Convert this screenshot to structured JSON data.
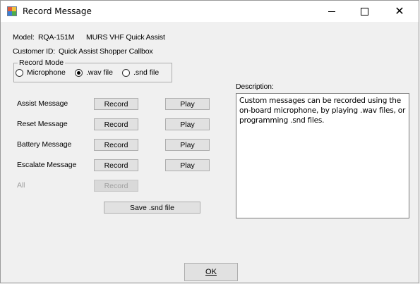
{
  "window": {
    "title": "Record Message",
    "icon": "app-window-icon",
    "controls": {
      "minimize": "minimize-icon",
      "maximize": "maximize-icon",
      "close": "close-icon"
    }
  },
  "info": {
    "model_label": "Model:",
    "model_value": "RQA-151M",
    "model_desc": "MURS VHF Quick Assist",
    "customer_label": "Customer ID:",
    "customer_value": "Quick Assist Shopper Callbox"
  },
  "record_mode": {
    "title": "Record Mode",
    "options": [
      {
        "label": "Microphone",
        "checked": false
      },
      {
        "label": ".wav file",
        "checked": true
      },
      {
        "label": ".snd file",
        "checked": false
      }
    ]
  },
  "messages": [
    {
      "label": "Assist Message",
      "record_label": "Record",
      "play_label": "Play"
    },
    {
      "label": "Reset Message",
      "record_label": "Record",
      "play_label": "Play"
    },
    {
      "label": "Battery Message",
      "record_label": "Record",
      "play_label": "Play"
    },
    {
      "label": "Escalate Message",
      "record_label": "Record",
      "play_label": "Play"
    }
  ],
  "all_row": {
    "label": "All",
    "record_label": "Record",
    "enabled": false
  },
  "save_button": "Save .snd file",
  "description": {
    "label": "Description:",
    "text": "Custom messages can be recorded using the on-board microphone, by playing .wav files, or programming .snd files."
  },
  "ok_button": "OK"
}
